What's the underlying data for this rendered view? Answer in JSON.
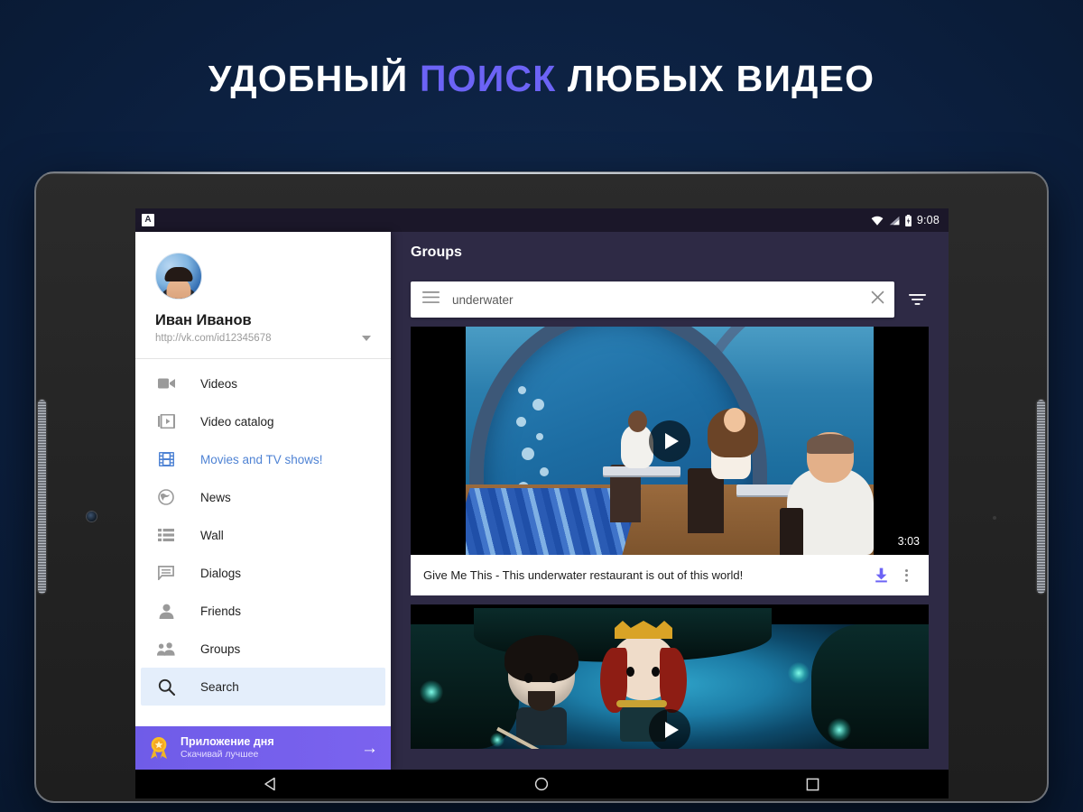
{
  "headline": {
    "part1": "УДОБНЫЙ ",
    "accent": "ПОИСК",
    "part2": " ЛЮБЫХ ВИДЕО",
    "accent_color": "#6c63f5"
  },
  "status_bar": {
    "notification_icon": "app-notification-icon",
    "notification_glyph": "A",
    "wifi_icon": "wifi-icon",
    "signal_icon": "cell-signal-icon",
    "battery_icon": "battery-icon",
    "time": "9:08"
  },
  "drawer": {
    "profile": {
      "avatar": "user-avatar",
      "name": "Иван Иванов",
      "url": "http://vk.com/id12345678",
      "expand_icon": "chevron-down-icon"
    },
    "items": [
      {
        "label": "Videos",
        "icon": "video-camera-icon",
        "highlighted": false,
        "selected": false
      },
      {
        "label": "Video catalog",
        "icon": "video-catalog-icon",
        "highlighted": false,
        "selected": false
      },
      {
        "label": "Movies and TV shows!",
        "icon": "film-strip-icon",
        "highlighted": true,
        "selected": false
      },
      {
        "label": "News",
        "icon": "globe-icon",
        "highlighted": false,
        "selected": false
      },
      {
        "label": "Wall",
        "icon": "list-icon",
        "highlighted": false,
        "selected": false
      },
      {
        "label": "Dialogs",
        "icon": "chat-bubble-icon",
        "highlighted": false,
        "selected": false
      },
      {
        "label": "Friends",
        "icon": "person-icon",
        "highlighted": false,
        "selected": false
      },
      {
        "label": "Groups",
        "icon": "people-icon",
        "highlighted": false,
        "selected": false
      },
      {
        "label": "Search",
        "icon": "search-icon",
        "highlighted": false,
        "selected": true
      }
    ],
    "promo": {
      "icon": "medal-icon",
      "title": "Приложение дня",
      "subtitle": "Скачивай лучшее",
      "arrow_icon": "arrow-right-icon",
      "color": "#7161ec"
    }
  },
  "content": {
    "toolbar_title": "Groups",
    "search": {
      "menu_icon": "hamburger-icon",
      "value": "underwater",
      "clear_icon": "close-icon",
      "filter_icon": "filter-icon"
    },
    "videos": [
      {
        "title": "Give Me This - This underwater restaurant is out of this world!",
        "duration": "3:03",
        "play_icon": "play-icon",
        "download_icon": "download-icon",
        "more_icon": "more-vertical-icon"
      },
      {
        "title": "",
        "duration": "",
        "play_icon": "play-icon",
        "download_icon": "download-icon",
        "more_icon": "more-vertical-icon"
      }
    ]
  },
  "navbar": {
    "back": "back-icon",
    "home": "home-icon",
    "recents": "recents-icon"
  },
  "theme": {
    "app_bar": "#2e2a45",
    "accent": "#6c63f5",
    "link_blue": "#4f83d4",
    "selected_bg": "#e4eefb"
  }
}
